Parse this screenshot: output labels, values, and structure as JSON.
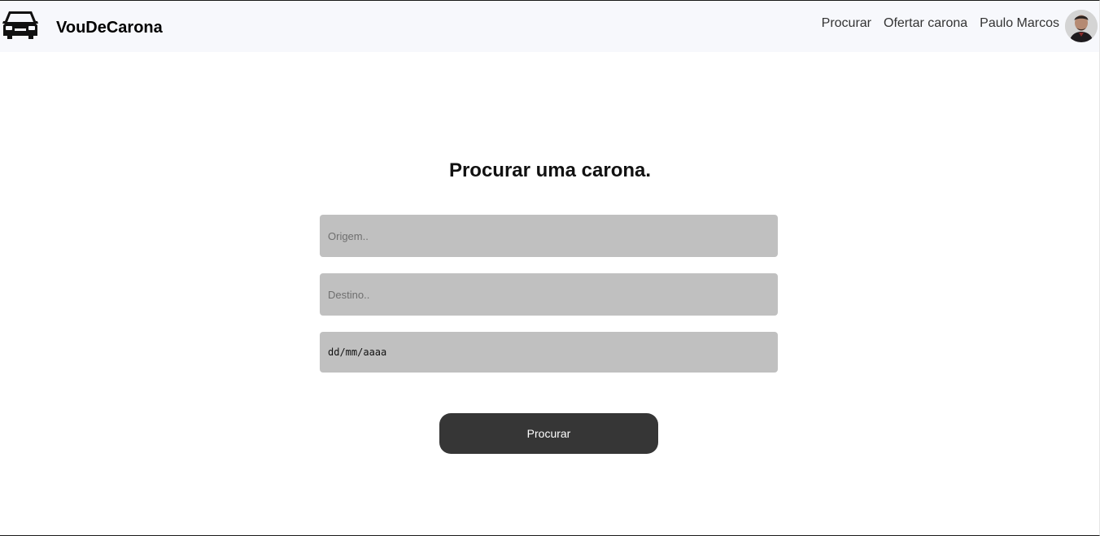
{
  "header": {
    "logo_icon": "car-icon",
    "brand": "VouDeCarona",
    "nav": [
      {
        "label": "Procurar"
      },
      {
        "label": "Ofertar carona"
      },
      {
        "label": "Paulo Marcos"
      }
    ],
    "avatar_icon": "user-avatar"
  },
  "main": {
    "title": "Procurar uma carona.",
    "origin_placeholder": "Origem..",
    "destination_placeholder": "Destino..",
    "date_placeholder": "dd/mm/aaaa",
    "submit_label": "Procurar"
  },
  "colors": {
    "navbar_bg": "#f7f8fc",
    "input_bg": "#c0c0c0",
    "button_bg": "#363636"
  }
}
